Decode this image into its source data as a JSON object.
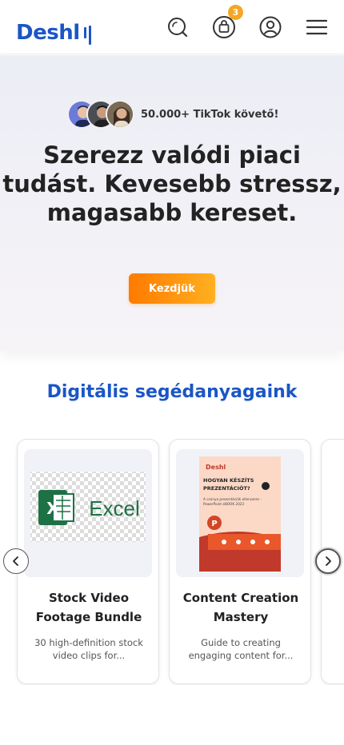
{
  "header": {
    "logo_text": "Deshl",
    "cart_count": "3",
    "icons": [
      "search-icon",
      "cart-icon",
      "account-icon",
      "menu-icon"
    ]
  },
  "hero": {
    "followers_text": "50.000+ TikTok követő!",
    "title": "Szerezz valódi piaci tudást. Kevesebb stressz, magasabb kereset.",
    "cta_label": "Kezdjük"
  },
  "products_section": {
    "title": "Digitális segédanyagaink",
    "cards": [
      {
        "title": "Stock Video Footage Bundle",
        "description": "30 high-definition stock video clips for...",
        "image_text": "Excel"
      },
      {
        "title": "Content Creation Mastery",
        "description": "Guide to creating engaging content for...",
        "image_brand": "Deshl",
        "image_heading": "HOGYAN KÉSZÍTS PREZENTÁCIÓT?",
        "image_sub": "A csúnya prezentációk ellenszere - PowerPoint eBOOK 2023"
      }
    ]
  },
  "colors": {
    "brand_blue": "#1b56c6",
    "cta_orange_start": "#ff7a00",
    "cta_orange_end": "#ffb020",
    "badge_orange": "#f5a623"
  }
}
